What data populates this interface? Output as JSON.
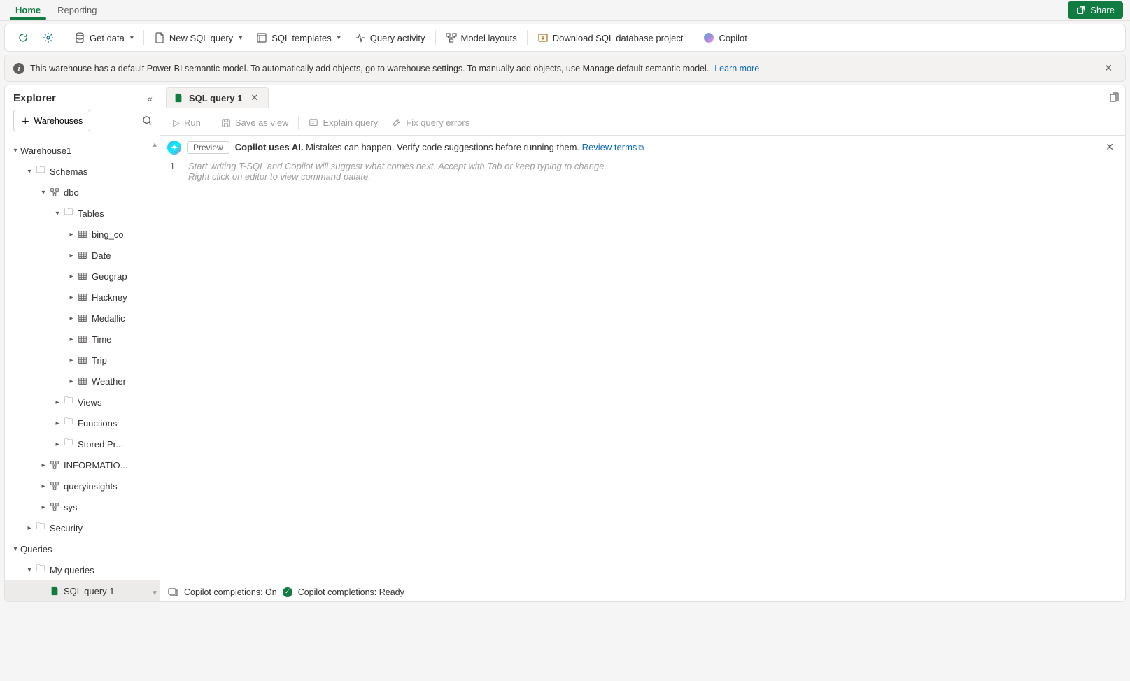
{
  "tabs": {
    "home": "Home",
    "reporting": "Reporting"
  },
  "share": "Share",
  "toolbar": {
    "get_data": "Get data",
    "new_sql": "New SQL query",
    "sql_templates": "SQL templates",
    "query_activity": "Query activity",
    "model_layouts": "Model layouts",
    "download": "Download SQL database project",
    "copilot": "Copilot"
  },
  "info": {
    "text": "This warehouse has a default Power BI semantic model. To automatically add objects, go to warehouse settings. To manually add objects, use Manage default semantic model.",
    "learn": "Learn more"
  },
  "explorer": {
    "title": "Explorer",
    "warehouses_btn": "Warehouses",
    "tree": {
      "warehouse1": "Warehouse1",
      "schemas": "Schemas",
      "dbo": "dbo",
      "tables": "Tables",
      "tbl": [
        "bing_co",
        "Date",
        "Geograp",
        "Hackney",
        "Medallic",
        "Time",
        "Trip",
        "Weather"
      ],
      "views": "Views",
      "functions": "Functions",
      "stored": "Stored Pr...",
      "info_schema": "INFORMATIO...",
      "queryinsights": "queryinsights",
      "sys": "sys",
      "security": "Security",
      "queries": "Queries",
      "my_queries": "My queries",
      "sql_query_1": "SQL query 1"
    }
  },
  "editor": {
    "tab": "SQL query 1",
    "actions": {
      "run": "Run",
      "save_view": "Save as view",
      "explain": "Explain query",
      "fix": "Fix query errors"
    },
    "copilot_banner": {
      "preview": "Preview",
      "bold": "Copilot uses AI.",
      "rest": "Mistakes can happen. Verify code suggestions before running them.",
      "link": "Review terms"
    },
    "gutter_1": "1",
    "placeholder_l1": "Start writing T-SQL and Copilot will suggest what comes next. Accept with Tab or keep typing to change.",
    "placeholder_l2": "Right click on editor to view command palate."
  },
  "status": {
    "completions": "Copilot completions: On",
    "ready": "Copilot completions: Ready"
  }
}
